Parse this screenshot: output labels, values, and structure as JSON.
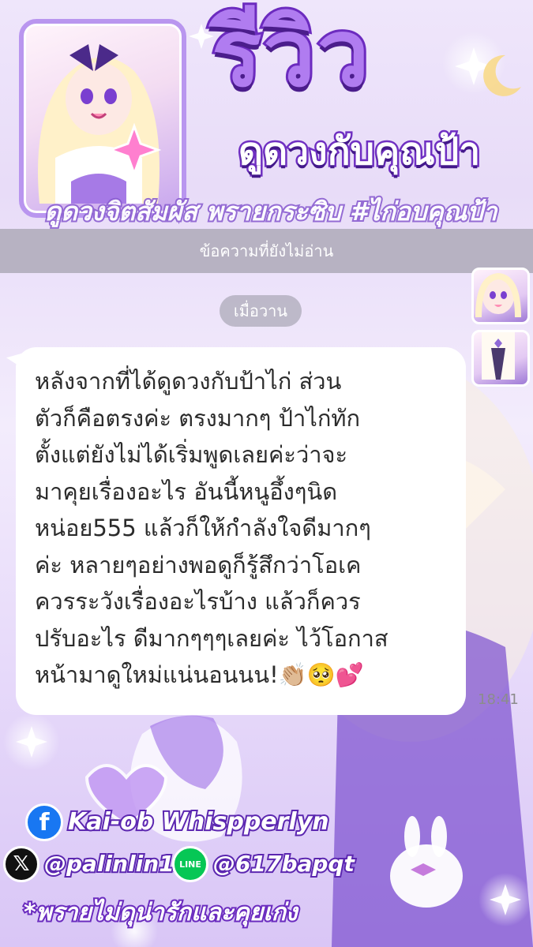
{
  "header": {
    "title": "รีวิว",
    "subtitle": "ดูดวงกับคุณป้า",
    "tagline": "ดูดวงจิตสัมผัส พรายกระซิบ #ไก่อบคุณป้า"
  },
  "chat": {
    "unread_label": "ข้อความที่ยังไม่อ่าน",
    "day_label": "เมื่อวาน",
    "message_lines": [
      "หลังจากที่ได้ดูดวงกับป้าไก่ ส่วน",
      "ตัวก็คือตรงค่ะ ตรงมากๆ ป้าไก่ทัก",
      "ตั้งแต่ยังไม่ได้เริ่มพูดเลยค่ะว่าจะ",
      "มาคุยเรื่องอะไร อันนี้หนูอึ้งๆนิด",
      "หน่อย555 แล้วก็ให้กำลังใจดีมากๆ",
      "ค่ะ หลายๆอย่างพอดูก็รู้สึกว่าโอเค",
      "ควรระวังเรื่องอะไรบ้าง แล้วก็ควร",
      "ปรับอะไร ดีมากๆๆๆเลยค่ะ ไว้โอกาส",
      "หน้ามาดูใหม่แน่นอนนน!👏🏼🥺💕"
    ],
    "time": "18:41"
  },
  "socials": {
    "facebook": "Kai-ob Whispperlyn",
    "x": "@palinlin19",
    "line": "@617bapqt",
    "line_icon_text": "LINE"
  },
  "footer_note": "*พรายไม่ดุน่ารักและคุยเก่ง",
  "colors": {
    "accent": "#b07cf0",
    "stroke": "#6c2bbf",
    "facebook": "#1877f2",
    "line": "#06c755"
  }
}
